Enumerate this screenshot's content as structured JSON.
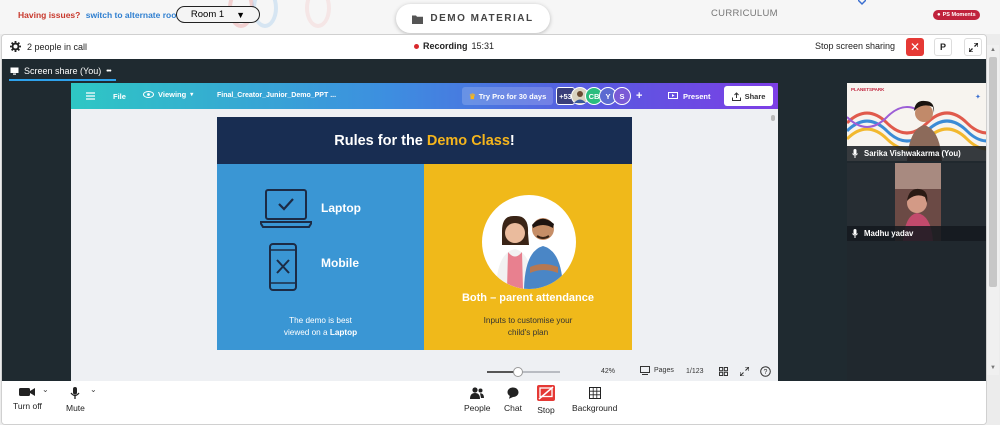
{
  "topbar": {
    "issue_question": "Having issues?",
    "issue_link": "switch to alternate room",
    "room": "Room 1",
    "demo_material": "DEMO MATERIAL",
    "curriculum": "CURRICULUM",
    "badge": "PS Moments"
  },
  "call": {
    "people_count": "2 people in call",
    "recording_label": "Recording",
    "recording_time": "15:31",
    "stop_sharing": "Stop screen sharing",
    "p_button": "P"
  },
  "share": {
    "label": "Screen share (You)",
    "more": "•••"
  },
  "canva": {
    "file": "File",
    "viewing": "Viewing",
    "doc_title": "Final_Creator_Junior_Demo_PPT ...",
    "try_pro": "Try Pro for 30 days",
    "extra_count": "+53",
    "avatar_cb": "CB",
    "avatar_y": "Y",
    "avatar_s": "S",
    "plus": "+",
    "present": "Present",
    "share": "Share",
    "zoom": "42%",
    "zoom_level": 0.42,
    "pages_label": "Pages",
    "page_count": "1/123"
  },
  "slide": {
    "title_prefix": "Rules for the",
    "title_highlight": "Demo Class",
    "title_suffix": "!",
    "laptop": "Laptop",
    "mobile": "Mobile",
    "note_line1": "The demo is best",
    "note_line2_prefix": "viewed on a",
    "note_line2_bold": "Laptop",
    "both": "Both – parent attendance",
    "inputs_line1": "Inputs to customise your",
    "inputs_line2": "child's plan",
    "colors": {
      "header": "#182d52",
      "left": "#3a96d4",
      "right": "#f0b91a",
      "accent": "#f5b51c"
    }
  },
  "participants": [
    {
      "name": "Sarika Vishwakarma (You)",
      "logo": "PLANETSPARK"
    },
    {
      "name": "Madhu yadav"
    }
  ],
  "footer": {
    "turn_off": "Turn off",
    "mute": "Mute",
    "people": "People",
    "chat": "Chat",
    "stop": "Stop",
    "background": "Background"
  }
}
